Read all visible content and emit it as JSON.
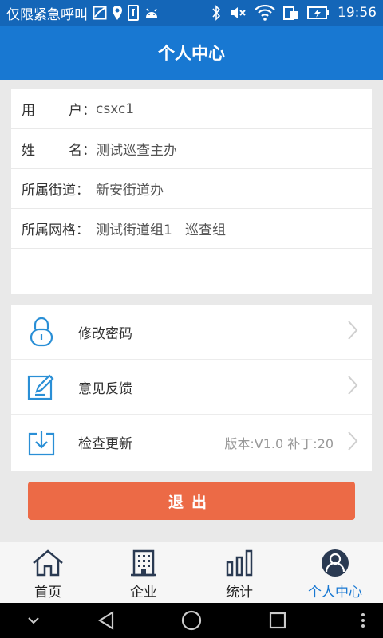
{
  "status_bar": {
    "carrier_text": "仅限紧急呼叫",
    "time": "19:56"
  },
  "header": {
    "title": "个人中心"
  },
  "profile": {
    "rows": [
      {
        "label_a": "用",
        "label_b": "户：",
        "value": "csxc1"
      },
      {
        "label_a": "姓",
        "label_b": "名：",
        "value": "测试巡查主办"
      },
      {
        "label": "所属街道：",
        "value": "新安街道办"
      },
      {
        "label": "所属网格：",
        "value": "测试街道组1   巡查组"
      }
    ]
  },
  "menu": {
    "items": [
      {
        "label": "修改密码",
        "icon": "lock-icon"
      },
      {
        "label": "意见反馈",
        "icon": "edit-icon"
      },
      {
        "label": "检查更新",
        "icon": "download-icon",
        "extra": "版本:V1.0 补丁:20"
      }
    ]
  },
  "logout_label": "退出",
  "tabs": [
    {
      "label": "首页",
      "icon": "home-icon",
      "active": false
    },
    {
      "label": "企业",
      "icon": "building-icon",
      "active": false
    },
    {
      "label": "统计",
      "icon": "bar-chart-icon",
      "active": false
    },
    {
      "label": "个人中心",
      "icon": "user-icon",
      "active": true
    }
  ],
  "colors": {
    "header_blue": "#1878d2",
    "status_blue": "#1466b8",
    "logout_orange": "#ec6a46",
    "icon_blue": "#2a8fd6",
    "tab_dark": "#2a3a52"
  }
}
